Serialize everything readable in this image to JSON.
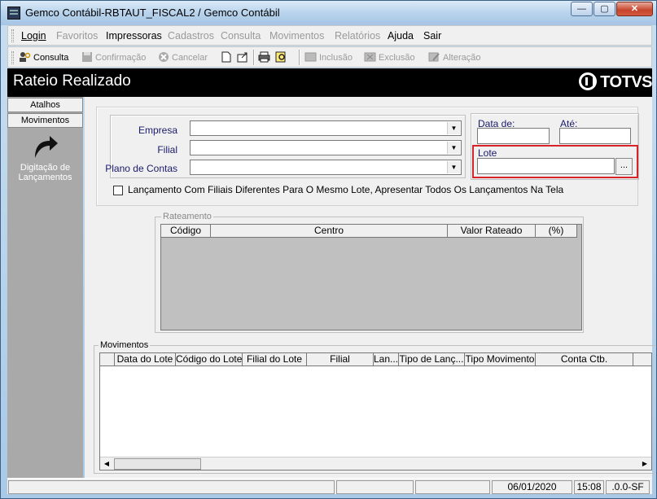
{
  "window": {
    "title": "Gemco Contábil-RBTAUT_FISCAL2 / Gemco Contábil",
    "minimize": "—",
    "maximize": "▢",
    "close": "✕"
  },
  "menu": {
    "items": [
      {
        "label": "Login",
        "enabled": true
      },
      {
        "label": "Favoritos",
        "enabled": false
      },
      {
        "label": "Impressoras",
        "enabled": true
      },
      {
        "label": "Cadastros",
        "enabled": false
      },
      {
        "label": "Consulta",
        "enabled": false
      },
      {
        "label": "Movimentos",
        "enabled": false
      },
      {
        "label": "Relatórios",
        "enabled": false
      },
      {
        "label": "Ajuda",
        "enabled": true
      },
      {
        "label": "Sair",
        "enabled": true
      }
    ]
  },
  "toolbar": {
    "consulta": "Consulta",
    "confirmacao": "Confirmação",
    "cancelar": "Cancelar",
    "inclusao": "Inclusão",
    "exclusao": "Exclusão",
    "alteracao": "Alteração"
  },
  "header": {
    "title": "Rateio Realizado",
    "brand": "TOTVS"
  },
  "sidebar": {
    "tabs": [
      "Atalhos",
      "Movimentos"
    ],
    "action_line1": "Digitação de",
    "action_line2": "Lançamentos"
  },
  "form": {
    "empresa_label": "Empresa",
    "filial_label": "Filial",
    "plano_label": "Plano de Contas",
    "empresa_value": "",
    "filial_value": "",
    "plano_value": "",
    "data_de_label": "Data de:",
    "ate_label": "Até:",
    "data_de_value": "",
    "ate_value": "",
    "lote_label": "Lote",
    "lote_value": "",
    "lote_button": "...",
    "checkbox_label": "Lançamento Com Filiais Diferentes Para O Mesmo Lote, Apresentar Todos Os Lançamentos Na Tela",
    "checkbox_checked": false
  },
  "rateamento": {
    "legend": "Rateamento",
    "columns": [
      "Código",
      "Centro",
      "Valor Rateado",
      "(%)"
    ],
    "rows": []
  },
  "movimentos": {
    "legend": "Movimentos",
    "columns": [
      "Data do Lote",
      "Código do Lote",
      "Filial do Lote",
      "Filial",
      "Lan...",
      "Tipo de Lanç...",
      "Tipo Movimento",
      "Conta Ctb."
    ],
    "rows": []
  },
  "statusbar": {
    "date": "06/01/2020",
    "time": "15:08",
    "version": ".0.0-SF"
  }
}
